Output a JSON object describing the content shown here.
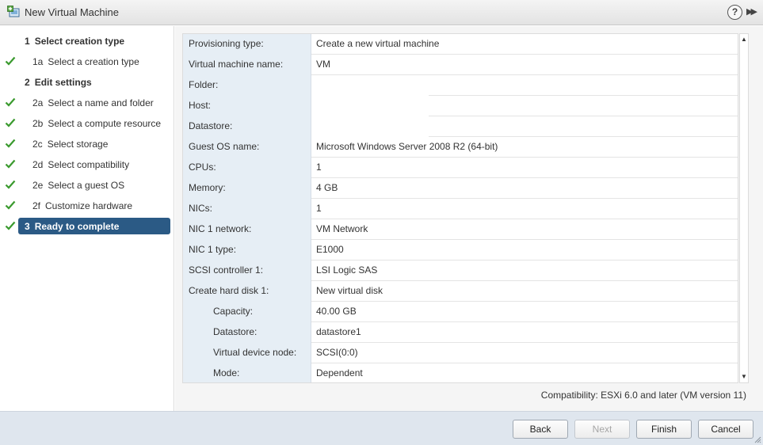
{
  "window": {
    "title": "New Virtual Machine",
    "help_glyph": "?",
    "expand_glyph": "▶▶"
  },
  "steps": [
    {
      "number": "1",
      "label": "Select creation type",
      "level": "header",
      "checked": false
    },
    {
      "number": "1a",
      "label": "Select a creation type",
      "level": "sub",
      "checked": true
    },
    {
      "number": "2",
      "label": "Edit settings",
      "level": "header",
      "checked": false
    },
    {
      "number": "2a",
      "label": "Select a name and folder",
      "level": "sub",
      "checked": true
    },
    {
      "number": "2b",
      "label": "Select a compute resource",
      "level": "sub",
      "checked": true
    },
    {
      "number": "2c",
      "label": "Select storage",
      "level": "sub",
      "checked": true
    },
    {
      "number": "2d",
      "label": "Select compatibility",
      "level": "sub",
      "checked": true
    },
    {
      "number": "2e",
      "label": "Select a guest OS",
      "level": "sub",
      "checked": true
    },
    {
      "number": "2f",
      "label": "Customize hardware",
      "level": "sub",
      "checked": true
    },
    {
      "number": "3",
      "label": "Ready to complete",
      "level": "active",
      "checked": true
    }
  ],
  "summary": [
    {
      "label": "Provisioning type:",
      "value": "Create a new virtual machine",
      "indent": false
    },
    {
      "label": "Virtual machine name:",
      "value": "VM",
      "indent": false
    },
    {
      "label": "Folder:",
      "value": "",
      "indent": false
    },
    {
      "label": "Host:",
      "value": "",
      "indent": false
    },
    {
      "label": "Datastore:",
      "value": "",
      "indent": false
    },
    {
      "label": "Guest OS name:",
      "value": "Microsoft Windows Server 2008 R2 (64-bit)",
      "indent": false
    },
    {
      "label": "CPUs:",
      "value": "1",
      "indent": false
    },
    {
      "label": "Memory:",
      "value": "4 GB",
      "indent": false
    },
    {
      "label": "NICs:",
      "value": "1",
      "indent": false
    },
    {
      "label": "NIC 1 network:",
      "value": "VM Network",
      "indent": false
    },
    {
      "label": "NIC 1 type:",
      "value": "E1000",
      "indent": false
    },
    {
      "label": "SCSI controller 1:",
      "value": "LSI Logic SAS",
      "indent": false
    },
    {
      "label": "Create hard disk 1:",
      "value": "New virtual disk",
      "indent": false
    },
    {
      "label": "Capacity:",
      "value": "40.00 GB",
      "indent": true
    },
    {
      "label": "Datastore:",
      "value": "datastore1",
      "indent": true
    },
    {
      "label": "Virtual device node:",
      "value": "SCSI(0:0)",
      "indent": true
    },
    {
      "label": "Mode:",
      "value": "Dependent",
      "indent": true
    }
  ],
  "scrollbar": {
    "up_glyph": "▲",
    "down_glyph": "▼"
  },
  "compatibility": "Compatibility: ESXi 6.0 and later (VM version 11)",
  "buttons": {
    "back": "Back",
    "next": "Next",
    "finish": "Finish",
    "cancel": "Cancel"
  },
  "colors": {
    "active_step": "#2b5a85",
    "check": "#3a9a2e",
    "label_cell": "#e6eef5"
  }
}
